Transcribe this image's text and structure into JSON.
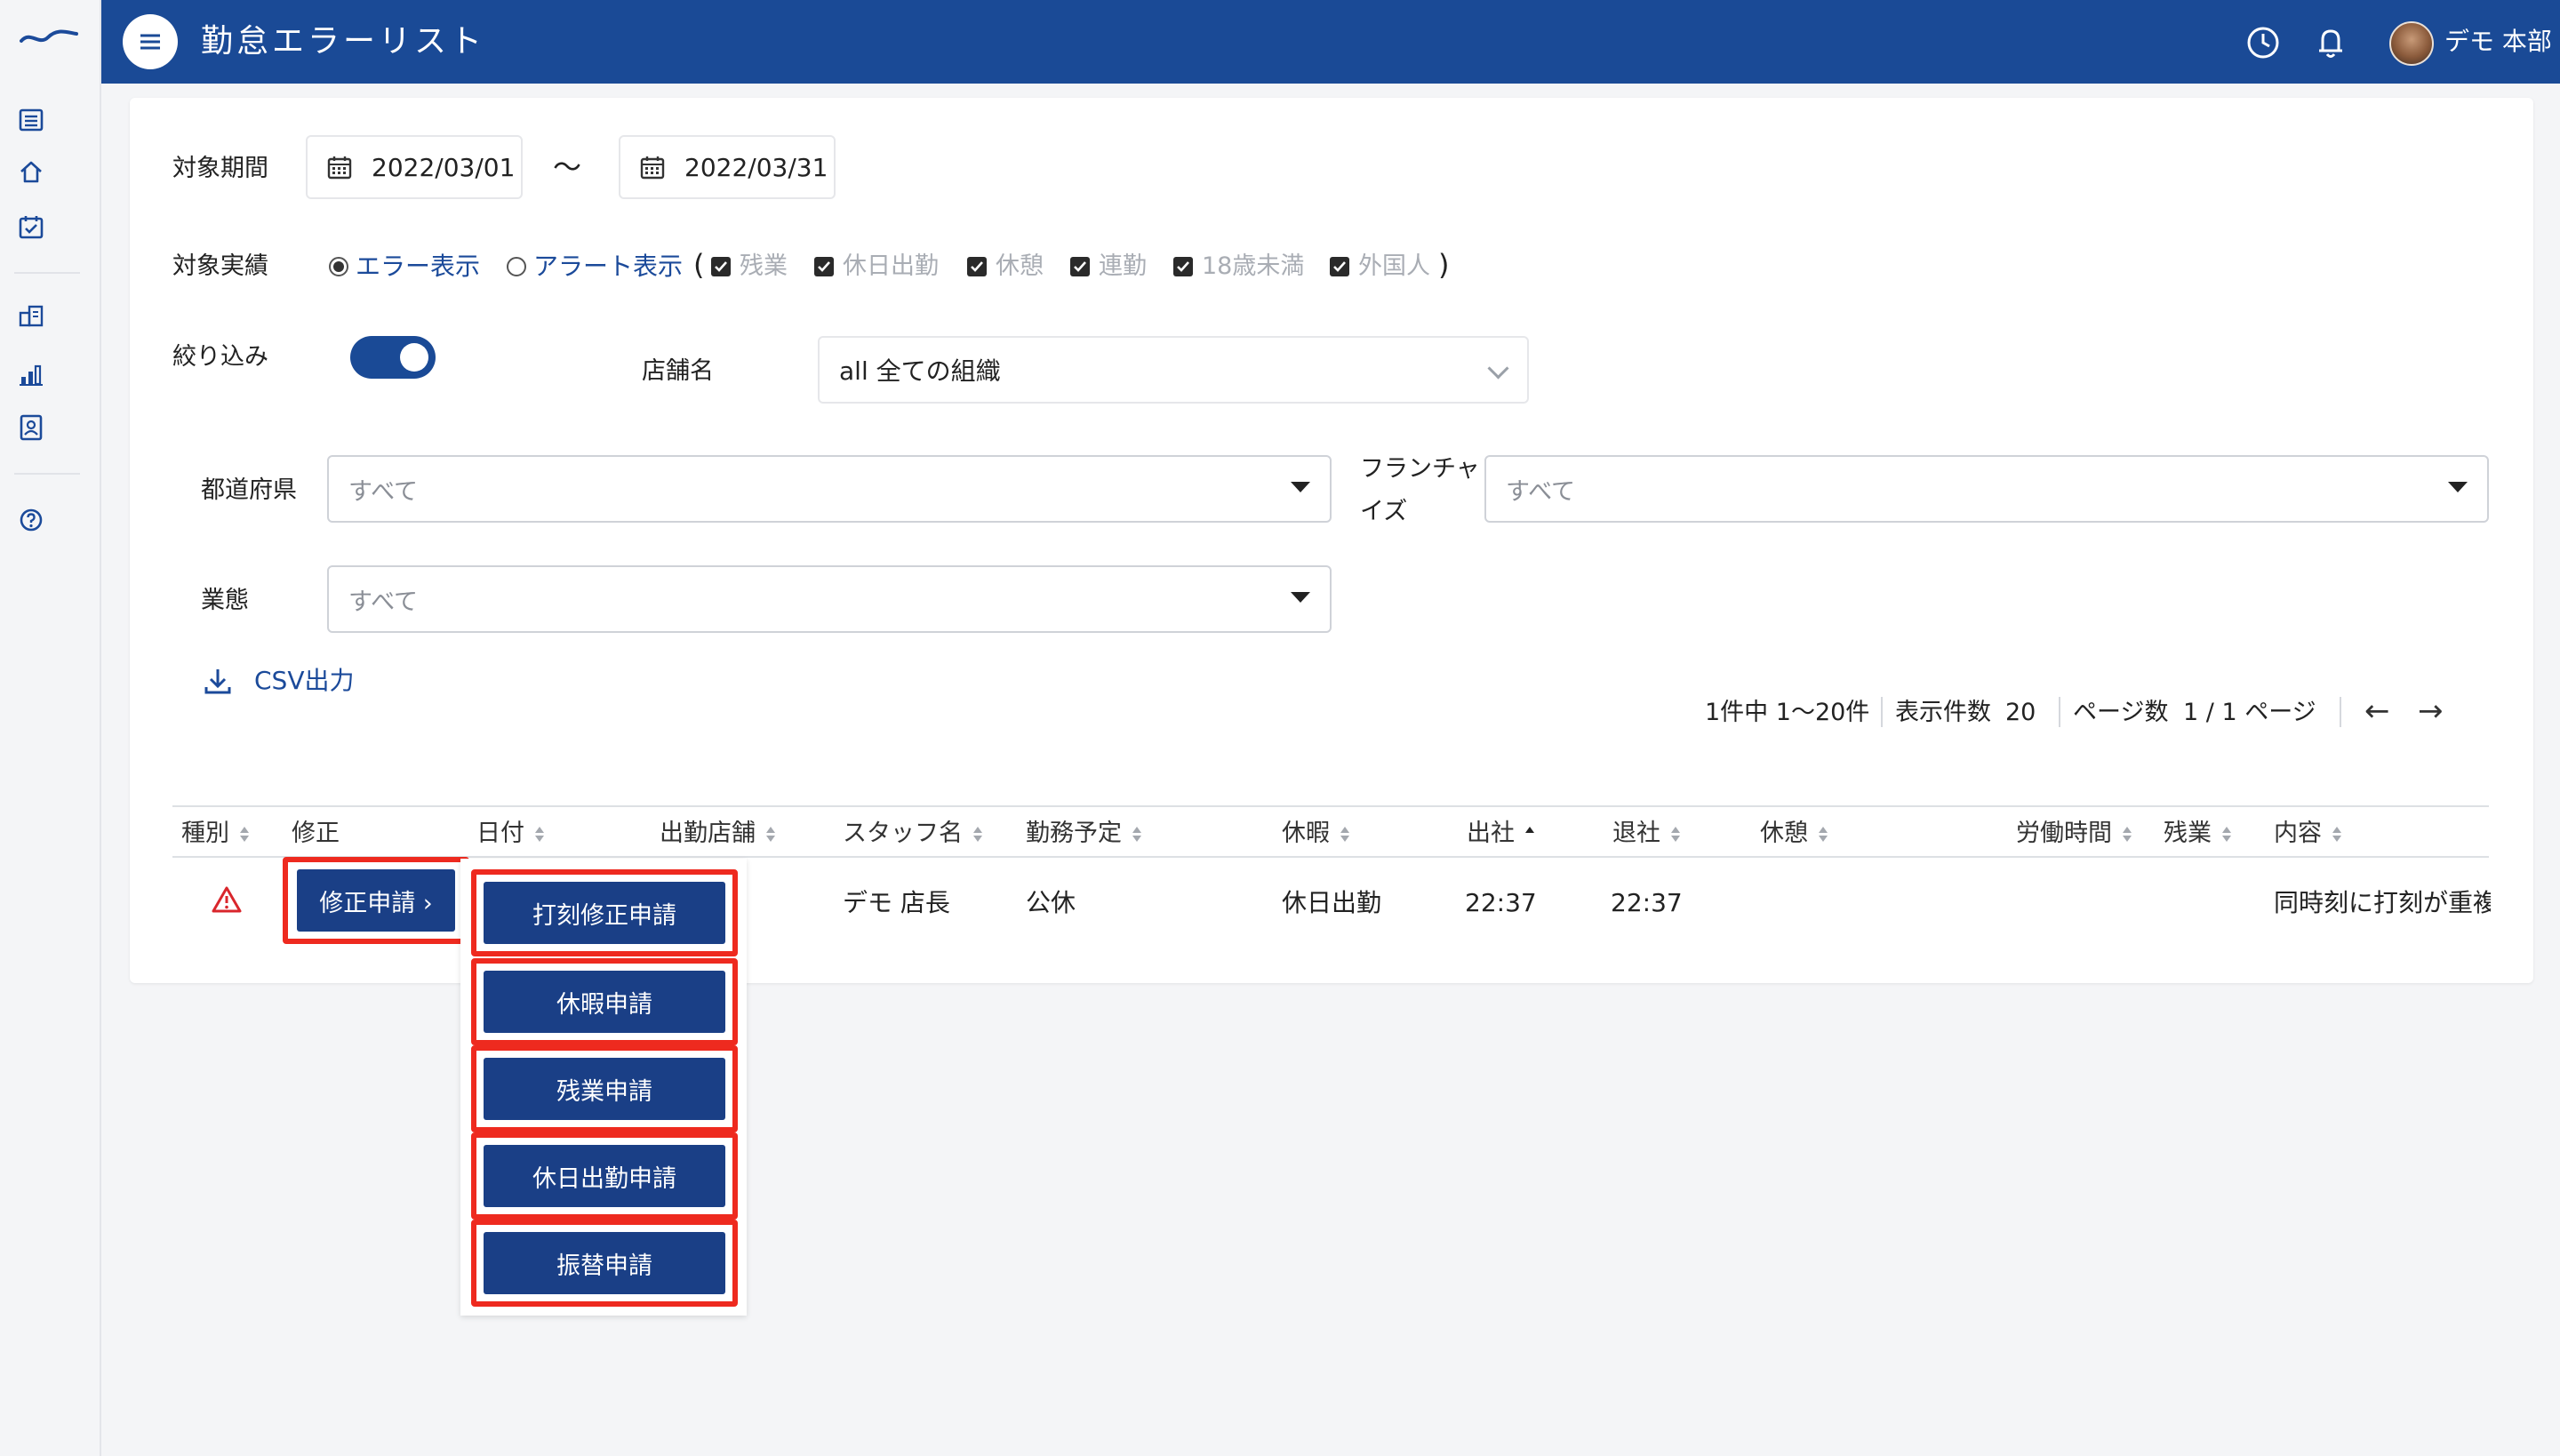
{
  "header": {
    "title": "勤怠エラーリスト",
    "user_name": "デモ 本部"
  },
  "filters": {
    "period_label": "対象期間",
    "date_from": "2022/03/01",
    "date_tilde": "〜",
    "date_to": "2022/03/31",
    "record_label": "対象実績",
    "radio_error": "エラー表示",
    "radio_alert": "アラート表示",
    "paren_open": "(",
    "paren_close": ")",
    "checks": [
      "残業",
      "休日出勤",
      "休憩",
      "連勤",
      "18歳未満",
      "外国人"
    ],
    "narrow_label": "絞り込み",
    "store_label": "店舗名",
    "store_value": "all 全ての組織",
    "prefecture_label": "都道府県",
    "prefecture_value": "すべて",
    "franchise_label_1": "フランチャ",
    "franchise_label_2": "イズ",
    "franchise_value": "すべて",
    "business_label": "業態",
    "business_value": "すべて",
    "csv_label": "CSV出力"
  },
  "pagination": {
    "summary": "1件中 1〜20件",
    "per_page_label": "表示件数",
    "per_page": "20",
    "page_label": "ページ数",
    "page_value": "1 / 1 ページ",
    "prev": "←",
    "next": "→"
  },
  "table": {
    "columns": [
      "種別",
      "修正",
      "日付",
      "出勤店舗",
      "スタッフ名",
      "勤務予定",
      "休暇",
      "出社",
      "退社",
      "休憩",
      "労働時間",
      "残業",
      "内容"
    ],
    "row": {
      "staff": "デモ 店長",
      "schedule": "公休",
      "leave": "休日出勤",
      "in_time": "22:37",
      "out_time": "22:37",
      "content": "同時刻に打刻が重複"
    },
    "edit_button": "修正申請 ›",
    "menu": [
      "打刻修正申請",
      "休暇申請",
      "残業申請",
      "休日出勤申請",
      "振替申請"
    ]
  },
  "colors": {
    "header_bg": "#1a4a96",
    "button_bg": "#1a3f86",
    "highlight": "#ee2a1f",
    "warning": "#d9262c"
  }
}
